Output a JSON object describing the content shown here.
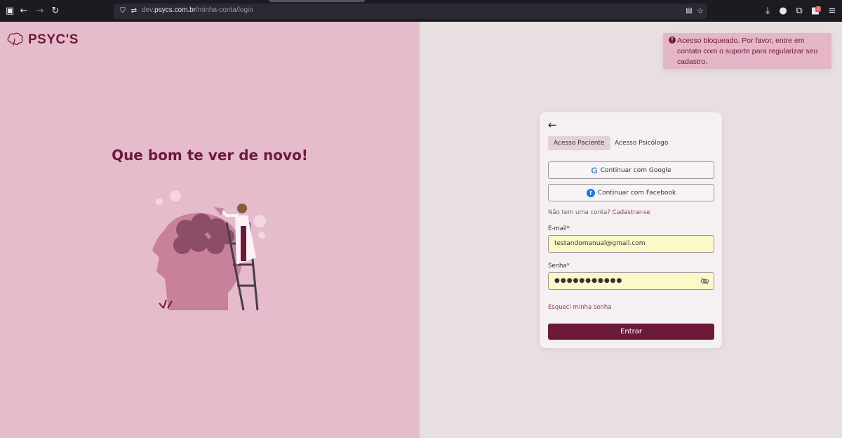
{
  "browser": {
    "url_prefix": "dev.",
    "url_domain": "psycs.com.br",
    "url_path": "/minha-conta/login",
    "extensions_badge": "2"
  },
  "brand": {
    "logo_text": "PSYC'S"
  },
  "hero": {
    "headline": "Que bom te ver de novo!"
  },
  "alert": {
    "message": "Acesso bloqueado. Por favor, entre em contato com o suporte para regularizar seu cadastro."
  },
  "login": {
    "tabs": [
      {
        "label": "Acesso Paciente",
        "active": true
      },
      {
        "label": "Acesso Psicólogo",
        "active": false
      }
    ],
    "google_label": "Continuar com Google",
    "facebook_label": "Continuar com Facebook",
    "signup_prompt": "Não tem uma conta?",
    "signup_link": "Cadastrar-se",
    "email_label": "E-mail*",
    "email_value": "testandomanual@gmail.com",
    "password_label": "Senha*",
    "password_value": "●●●●●●●●●●●",
    "forgot_label": "Esqueci minha senha",
    "submit_label": "Entrar"
  },
  "colors": {
    "brand": "#6d1a3a",
    "left_bg": "#e5bccb",
    "right_bg": "#e8dfe1",
    "alert_bg": "#e5b6c7",
    "autofill": "#fdf8c8"
  }
}
